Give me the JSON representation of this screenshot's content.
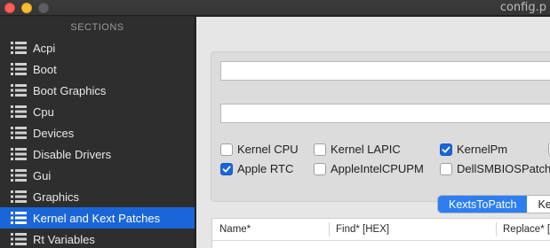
{
  "window": {
    "title": "config.p"
  },
  "sidebar": {
    "header": "SECTIONS",
    "items": [
      {
        "label": "Acpi"
      },
      {
        "label": "Boot"
      },
      {
        "label": "Boot Graphics"
      },
      {
        "label": "Cpu"
      },
      {
        "label": "Devices"
      },
      {
        "label": "Disable Drivers"
      },
      {
        "label": "Gui"
      },
      {
        "label": "Graphics"
      },
      {
        "label": "Kernel and Kext Patches",
        "selected": true
      },
      {
        "label": "Rt Variables"
      }
    ]
  },
  "main": {
    "field1_value": "",
    "field2_value": "",
    "checkboxes": [
      {
        "label": "Kernel CPU",
        "checked": false
      },
      {
        "label": "Kernel LAPIC",
        "checked": false
      },
      {
        "label": "KernelPm",
        "checked": true
      },
      {
        "label": "Apple RTC",
        "checked": true
      },
      {
        "label": "AppleIntelCPUPM",
        "checked": false
      },
      {
        "label": "DellSMBIOSPatch",
        "checked": false
      }
    ],
    "tabs": [
      {
        "label": "KextsToPatch",
        "active": true
      },
      {
        "label": "Ke",
        "active": false
      }
    ],
    "table": {
      "columns": [
        "Name*",
        "Find* [HEX]",
        "Replace* [HEX]"
      ]
    }
  },
  "colors": {
    "accent": "#1a66d8",
    "close": "#fe5f57",
    "minimize": "#febc2e"
  }
}
